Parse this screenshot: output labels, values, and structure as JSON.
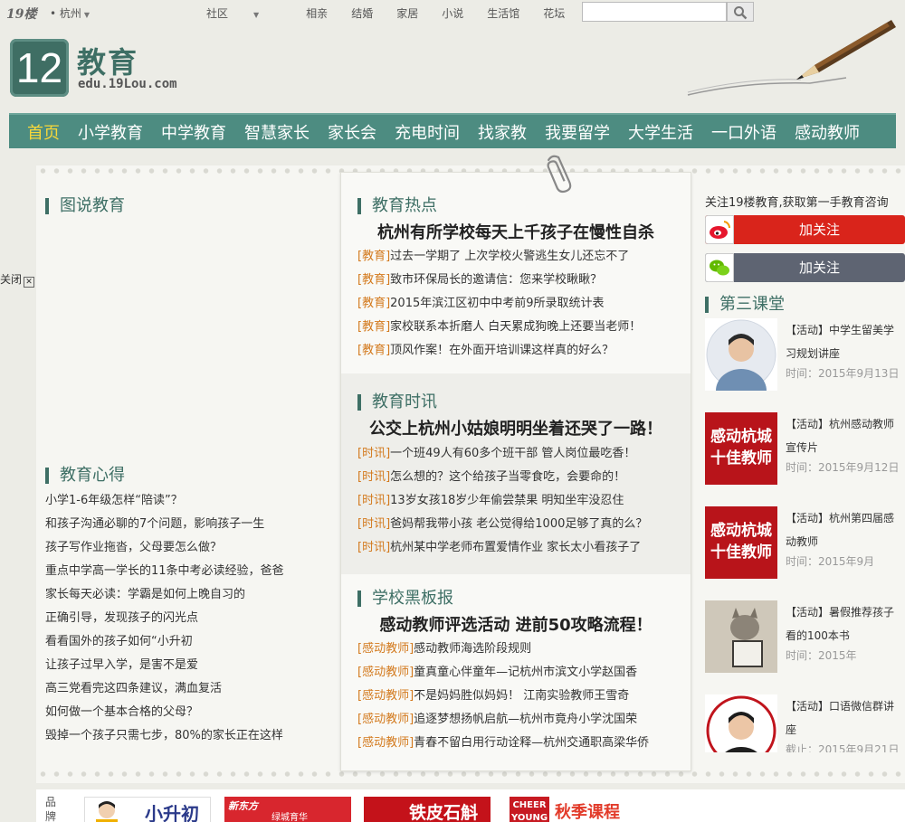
{
  "topbar": {
    "site": "19楼",
    "city": "杭州",
    "nav": [
      {
        "label": "社区",
        "has_dropdown": true
      },
      {
        "label": "相亲"
      },
      {
        "label": "结婚"
      },
      {
        "label": "家居"
      },
      {
        "label": "小说"
      },
      {
        "label": "生活馆"
      },
      {
        "label": "花坛"
      },
      {
        "label": "我家"
      }
    ],
    "search_placeholder": ""
  },
  "header": {
    "logo_number": "12",
    "title": "教育",
    "url": "edu.19Lou.com"
  },
  "main_nav": [
    "首页",
    "小学教育",
    "中学教育",
    "智慧家长",
    "家长会",
    "充电时间",
    "找家教",
    "我要留学",
    "大学生活",
    "一口外语",
    "感动教师"
  ],
  "close_tab": "关闭",
  "left": {
    "tushuo_title": "图说教育",
    "xinde_title": "教育心得",
    "xinde_items": [
      "小学1-6年级怎样“陪读”？",
      "和孩子沟通必聊的7个问题，影响孩子一生",
      "孩子写作业拖沓，父母要怎么做？",
      "重点中学高一学长的11条中考必读经验，爸爸",
      "家长每天必读：学霸是如何上晚自习的",
      "正确引导，发现孩子的闪光点",
      "看看国外的孩子如何“小升初",
      "让孩子过早入学，是害不是爱",
      "高三党看完这四条建议，满血复活",
      "如何做一个基本合格的父母？",
      "毁掉一个孩子只需七步，80%的家长正在这样"
    ]
  },
  "center": {
    "sections": [
      {
        "title": "教育热点",
        "headline": "杭州有所学校每天上千孩子在慢性自杀",
        "items": [
          {
            "tag": "[教育]",
            "text": "过去一学期了 上次学校火警逃生女儿还忘不了"
          },
          {
            "tag": "[教育]",
            "text": "致市环保局长的邀请信：您来学校瞅瞅？"
          },
          {
            "tag": "[教育]",
            "text": "2015年滨江区初中中考前9所录取统计表"
          },
          {
            "tag": "[教育]",
            "text": "家校联系本折磨人 白天累成狗晚上还要当老师！"
          },
          {
            "tag": "[教育]",
            "text": "顶风作案！在外面开培训课这样真的好么？"
          }
        ]
      },
      {
        "title": "教育时讯",
        "headline": "公交上杭州小姑娘明明坐着还哭了一路！",
        "items": [
          {
            "tag": "[时讯]",
            "text": "一个班49人有60多个班干部 管人岗位最吃香！"
          },
          {
            "tag": "[时讯]",
            "text": "怎么想的？这个给孩子当零食吃，会要命的！"
          },
          {
            "tag": "[时讯]",
            "text": "13岁女孩18岁少年偷尝禁果 明知坐牢没忍住"
          },
          {
            "tag": "[时讯]",
            "text": "爸妈帮我带小孩 老公觉得给1000足够了真的么？"
          },
          {
            "tag": "[时讯]",
            "text": "杭州某中学老师布置爱情作业 家长太小看孩子了"
          }
        ]
      },
      {
        "title": "学校黑板报",
        "headline": "感动教师评选活动 进前50攻略流程！",
        "items": [
          {
            "tag": "[感动教师]",
            "text": "感动教师海选阶段规则"
          },
          {
            "tag": "[感动教师]",
            "text": "童真童心伴童年—记杭州市滨文小学赵国香"
          },
          {
            "tag": "[感动教师]",
            "text": "不是妈妈胜似妈妈！ 江南实验教师王雪奇"
          },
          {
            "tag": "[感动教师]",
            "text": "追逐梦想扬帆启航—杭州市竟舟小学沈国荣"
          },
          {
            "tag": "[感动教师]",
            "text": "青春不留白用行动诠释—杭州交通职高梁华侨"
          }
        ]
      }
    ]
  },
  "right": {
    "follow_text": "关注19楼教育,获取第一手教育咨询",
    "weibo_label": "加关注",
    "weixin_label": "加关注",
    "classroom_title": "第三课堂",
    "activities": [
      {
        "title": "【活动】中学生留美学习规划讲座",
        "time": "时间：2015年9月13日"
      },
      {
        "title": "【活动】杭州感动教师宣传片",
        "time": "时间：2015年9月12日",
        "thumb_text": "感动杭城十佳教师"
      },
      {
        "title": "【活动】杭州第四届感动教师",
        "time": "时间：2015年9月",
        "thumb_text": "感动杭城十佳教师"
      },
      {
        "title": "【活动】暑假推荐孩子看的100本书",
        "time": "时间：2015年"
      },
      {
        "title": "【活动】口语微信群讲座",
        "time": "截止：2015年9月21日"
      }
    ]
  },
  "brand_bar": {
    "label": "品牌",
    "brands": [
      "小升初",
      "新东方",
      "绿城育华",
      "铁皮石斛",
      "CHEER YOUNG",
      "秋季课程"
    ]
  },
  "colors": {
    "nav_bg": "#4d8c81",
    "accent": "#3e6f65",
    "active_nav": "#f7d83a",
    "tag": "#d37a1e",
    "weibo": "#d9241b",
    "weixin": "#5e6472"
  }
}
